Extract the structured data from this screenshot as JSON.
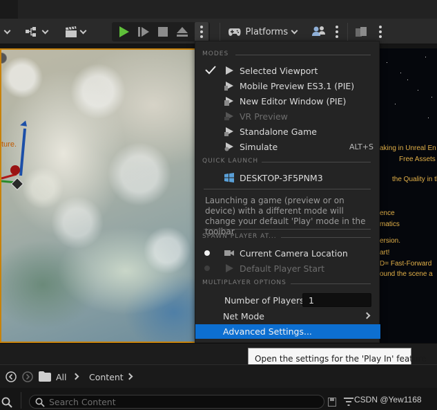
{
  "toolbar": {
    "platforms_label": "Platforms"
  },
  "menu": {
    "sections": {
      "modes": "MODES",
      "quick_launch": "QUICK LAUNCH",
      "spawn": "SPAWN PLAYER AT...",
      "multiplayer": "MULTIPLAYER OPTIONS"
    },
    "modes": [
      {
        "label": "Selected Viewport",
        "checked": true,
        "enabled": true
      },
      {
        "label": "Mobile Preview ES3.1 (PIE)",
        "enabled": true
      },
      {
        "label": "New Editor Window (PIE)",
        "enabled": true
      },
      {
        "label": "VR Preview",
        "enabled": false
      },
      {
        "label": "Standalone Game",
        "enabled": true
      },
      {
        "label": "Simulate",
        "enabled": true,
        "shortcut": "ALT+S"
      }
    ],
    "quick_launch_device": "DESKTOP-3F5PNM3",
    "info_text": "Launching a game (preview or on device) with a different mode will change your default 'Play' mode in the toolbar",
    "spawn_options": [
      {
        "label": "Current Camera Location",
        "selected": true,
        "enabled": true
      },
      {
        "label": "Default Player Start",
        "selected": false,
        "enabled": false
      }
    ],
    "number_of_players_label": "Number of Players",
    "number_of_players_value": "1",
    "net_mode_label": "Net Mode",
    "advanced_settings_label": "Advanced Settings..."
  },
  "tooltip": "Open the settings for the 'Play In' feature",
  "viewport": {
    "overlay_text": "ture."
  },
  "right_panel": {
    "lines": [
      "aking in Unreal En",
      "Free Assets on th",
      "the Quality in the",
      "ence",
      "matics",
      "ersion.",
      "art!",
      "D= Fast-Forward",
      "ound the scene a"
    ]
  },
  "content_browser": {
    "breadcrumb_all": "All",
    "breadcrumb_content": "Content",
    "search_placeholder": "Search Content"
  },
  "watermark": "CSDN @Yew1168",
  "colors": {
    "accent_blue": "#0d6fd1",
    "play_green": "#5fbf3a",
    "viewport_border": "#c8820a"
  }
}
